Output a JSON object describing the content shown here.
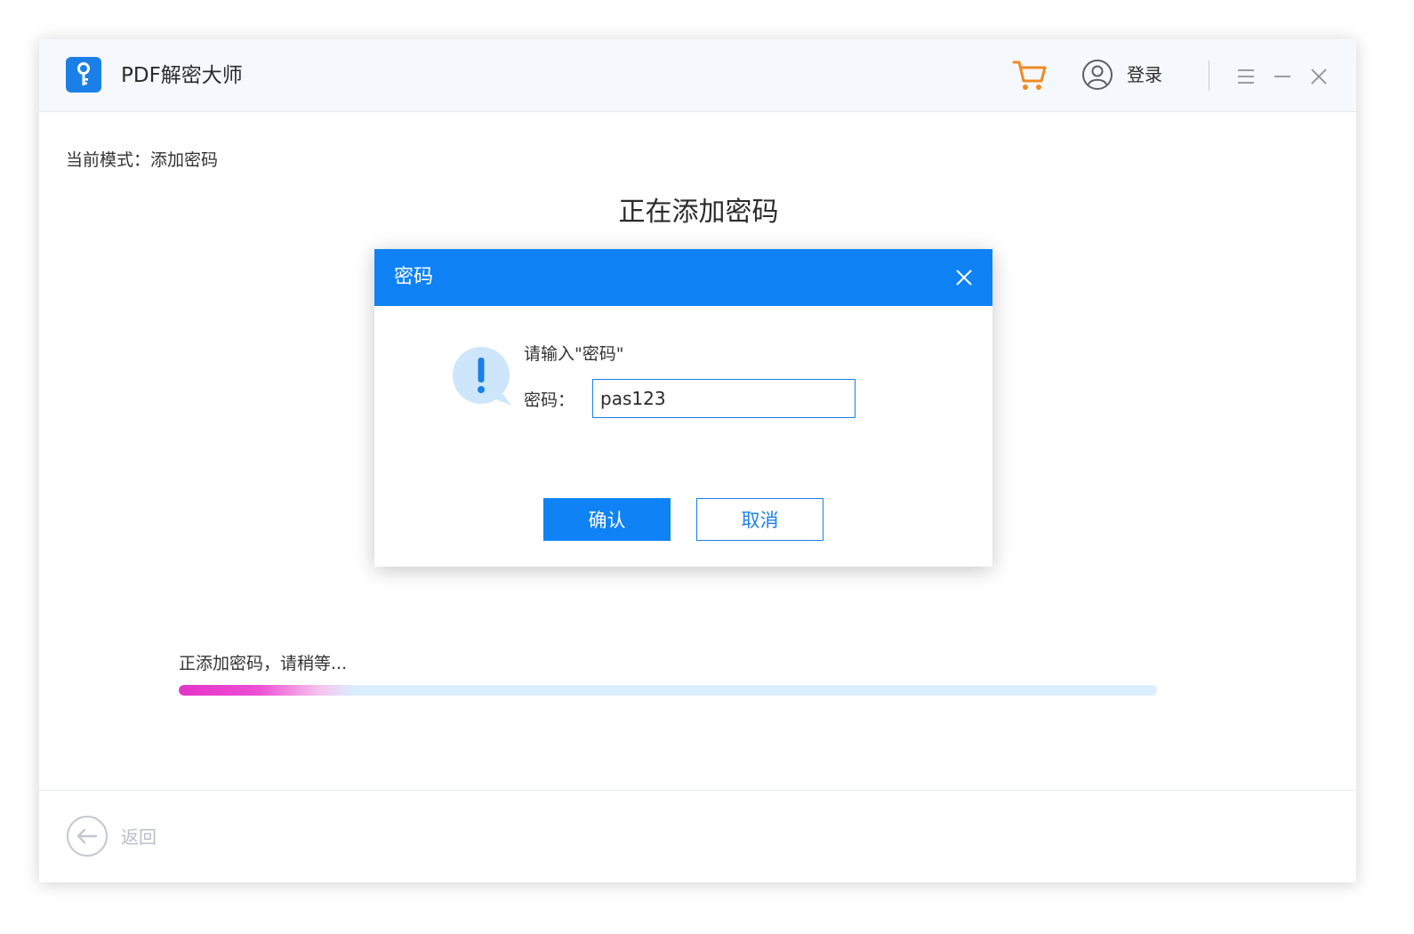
{
  "app": {
    "title": "PDF解密大师",
    "logo_icon": "key-icon",
    "brand_color": "#1a80e8"
  },
  "titlebar": {
    "cart_icon": "shopping-cart-icon",
    "user_icon": "user-icon",
    "login_label": "登录",
    "menu_icon": "hamburger-menu-icon",
    "minimize_icon": "minimize-icon",
    "close_icon": "close-icon"
  },
  "main": {
    "mode_label": "当前模式：添加密码",
    "heading": "正在添加密码",
    "progress": {
      "text": "正添加密码，请稍等...",
      "value": 0.18
    }
  },
  "dialog": {
    "title": "密码",
    "prompt": "请输入\"密码\"",
    "field_label": "密码：",
    "password_value": "pas123",
    "confirm_label": "确认",
    "cancel_label": "取消",
    "alert_icon": "exclamation-bubble-icon"
  },
  "footer": {
    "back_label": "返回",
    "back_icon": "arrow-left-circle-icon"
  }
}
